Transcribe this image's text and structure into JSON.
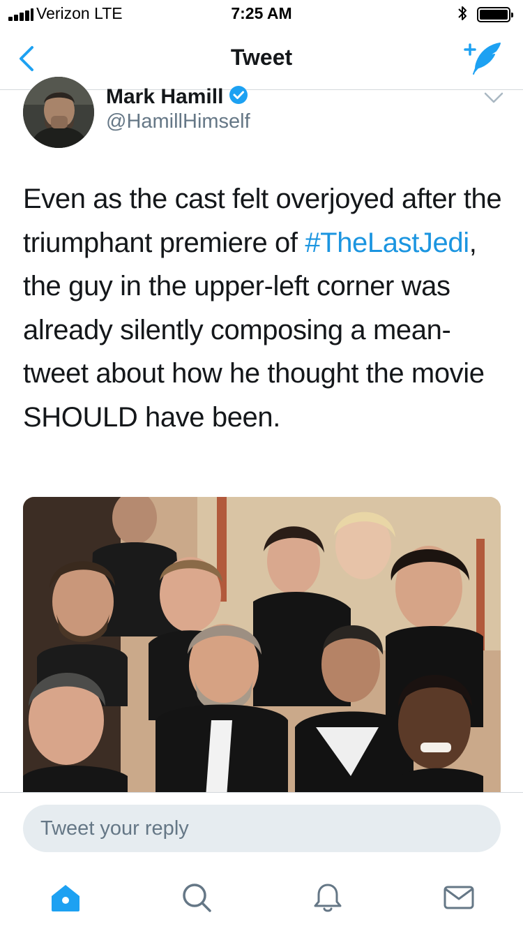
{
  "status_bar": {
    "carrier": "Verizon  LTE",
    "time": "7:25 AM"
  },
  "nav": {
    "title": "Tweet",
    "back_icon": "chevron-left-icon",
    "compose_icon": "compose-tweet-icon"
  },
  "tweet": {
    "display_name": "Mark Hamill",
    "handle": "@HamillHimself",
    "text_before": "Even as the cast felt overjoyed after the triumphant premiere of ",
    "hashtag": "#TheLastJedi",
    "text_after": ", the guy in the upper-left corner was already silently composing a mean-tweet about how he thought the movie SHOULD have been."
  },
  "reply": {
    "placeholder": "Tweet your reply"
  },
  "tabs": [
    {
      "name": "home-icon"
    },
    {
      "name": "search-icon"
    },
    {
      "name": "notifications-bell-icon"
    },
    {
      "name": "messages-envelope-icon"
    }
  ],
  "colors": {
    "accent": "#1da1f2",
    "link": "#1b95e0",
    "secondary_text": "#657786",
    "divider": "#d3d8dc",
    "reply_field": "#e6ecf0"
  }
}
